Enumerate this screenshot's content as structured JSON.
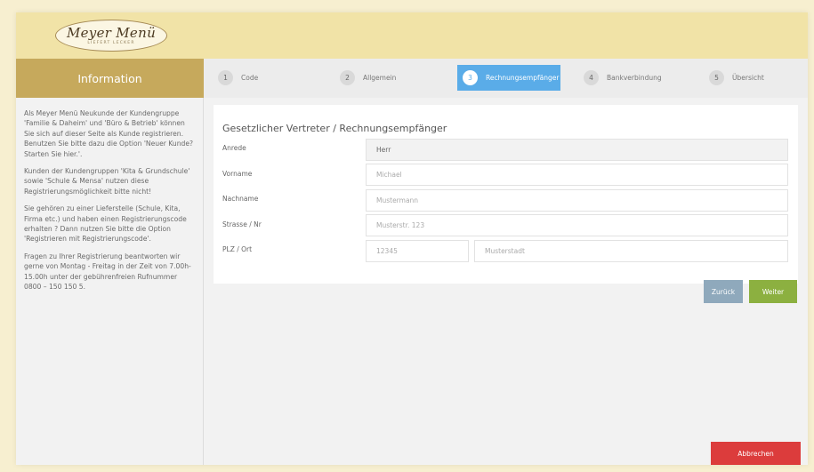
{
  "logo": {
    "main": "Meyer Menü",
    "sub": "LIEFERT LECKER"
  },
  "sidebar": {
    "title": "Information",
    "paragraphs": [
      "Als Meyer Menü Neukunde der Kundengruppe 'Familie & Daheim' und 'Büro & Betrieb' können Sie sich auf dieser Seite als Kunde registrieren. Benutzen Sie bitte dazu die Option 'Neuer Kunde? Starten Sie hier.'.",
      "Kunden der Kundengruppen 'Kita & Grundschule' sowie 'Schule & Mensa' nutzen diese Registrierungsmöglichkeit bitte nicht!",
      "Sie gehören zu einer Lieferstelle (Schule, Kita, Firma etc.) und haben einen Registrierungscode erhalten ? Dann nutzen Sie bitte die Option 'Registrieren mit Registrierungscode'.",
      "Fragen zu Ihrer Registrierung beantworten wir gerne von Montag - Freitag in der Zeit von 7.00h-15.00h unter der gebührenfreien Rufnummer 0800 – 150 150 5."
    ]
  },
  "steps": [
    {
      "num": "1",
      "label": "Code"
    },
    {
      "num": "2",
      "label": "Allgemein"
    },
    {
      "num": "3",
      "label": "Rechnungsempfänger"
    },
    {
      "num": "4",
      "label": "Bankverbindung"
    },
    {
      "num": "5",
      "label": "Übersicht"
    }
  ],
  "form": {
    "title": "Gesetzlicher Vertreter / Rechnungsempfänger",
    "anrede": {
      "label": "Anrede",
      "value": "Herr"
    },
    "vorname": {
      "label": "Vorname",
      "placeholder": "Michael"
    },
    "nachname": {
      "label": "Nachname",
      "placeholder": "Mustermann"
    },
    "strasse": {
      "label": "Strasse / Nr",
      "placeholder": "Musterstr. 123"
    },
    "plzort": {
      "label": "PLZ / Ort",
      "plz_placeholder": "12345",
      "ort_placeholder": "Musterstadt"
    }
  },
  "buttons": {
    "back": "Zurück",
    "next": "Weiter",
    "cancel": "Abbrechen"
  },
  "colors": {
    "header_bg": "#f1e3a7",
    "sidebar_head": "#c6a95c",
    "active_step": "#5aace8",
    "back_button": "#8fa9bc",
    "next_button": "#8cb040",
    "cancel_button": "#dc3c3c"
  }
}
